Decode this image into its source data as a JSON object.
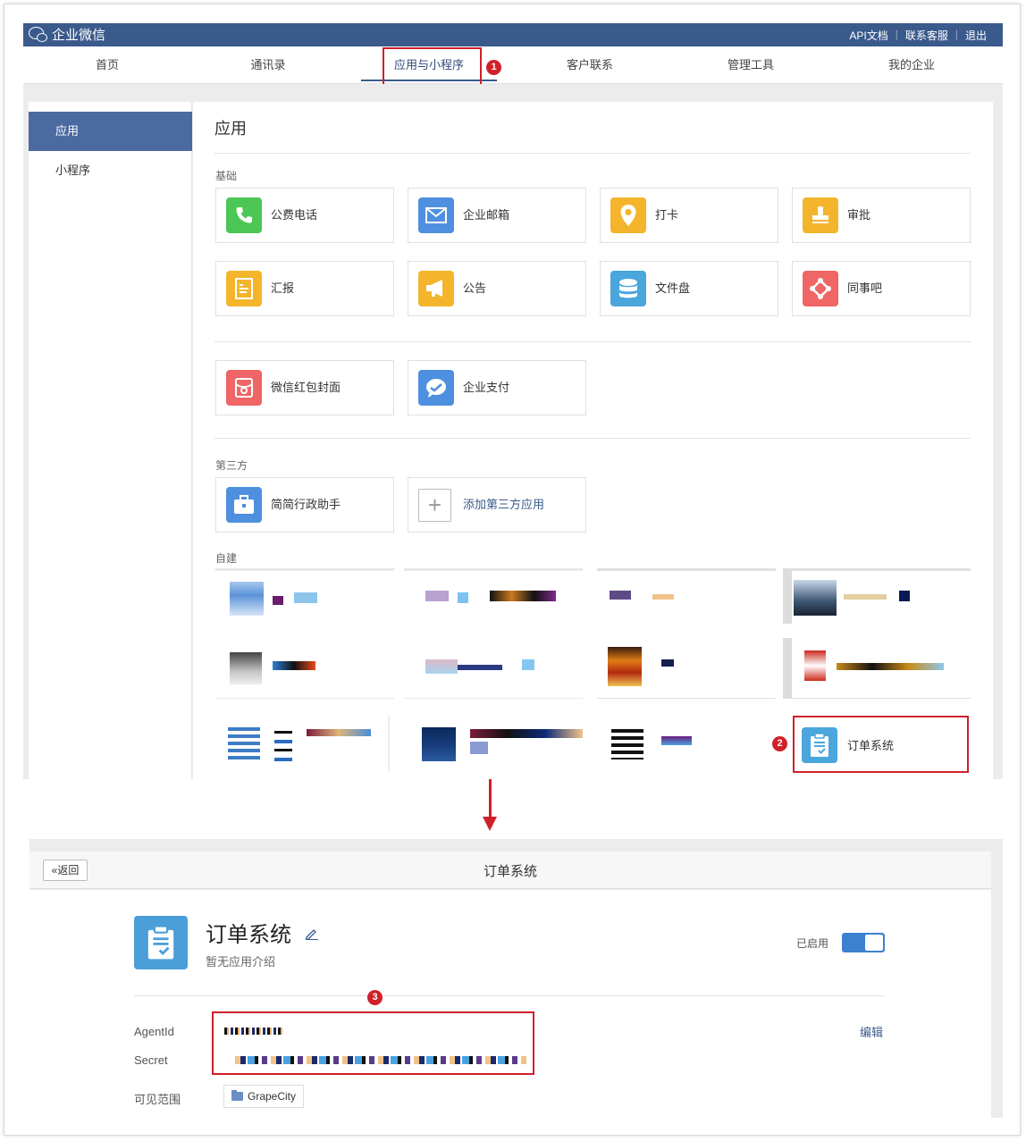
{
  "topbar": {
    "brand": "企业微信",
    "links": [
      "API文档",
      "联系客服",
      "退出"
    ]
  },
  "nav": {
    "items": [
      "首页",
      "通讯录",
      "应用与小程序",
      "客户联系",
      "管理工具",
      "我的企业"
    ],
    "active_index": 2
  },
  "badges": [
    "1",
    "2",
    "3"
  ],
  "sidebar": {
    "items": [
      "应用",
      "小程序"
    ]
  },
  "content": {
    "title": "应用",
    "sections": {
      "basic": "基础",
      "third": "第三方",
      "custom": "自建"
    },
    "basic_apps": [
      "公费电话",
      "企业邮箱",
      "打卡",
      "审批",
      "汇报",
      "公告",
      "文件盘",
      "同事吧"
    ],
    "extra_apps": [
      "微信红包封面",
      "企业支付"
    ],
    "third_apps": [
      "简简行政助手",
      "添加第三方应用"
    ],
    "custom_highlight": "订单系统"
  },
  "colors": {
    "topbar": "#3a5a8c",
    "accent_red": "#d0202a",
    "green": "#4cc655",
    "blue": "#4f8fe0",
    "yellow": "#f4b52c",
    "coral": "#f06565",
    "sky": "#4aa6dc"
  },
  "detail": {
    "back_label": "返回",
    "header_title": "订单系统",
    "app_name": "订单系统",
    "description": "暂无应用介绍",
    "status_label": "已启用",
    "fields": {
      "agent_id": "AgentId",
      "secret": "Secret",
      "scope": "可见范围"
    },
    "edit_label": "编辑",
    "scope_value": "GrapeCity"
  }
}
